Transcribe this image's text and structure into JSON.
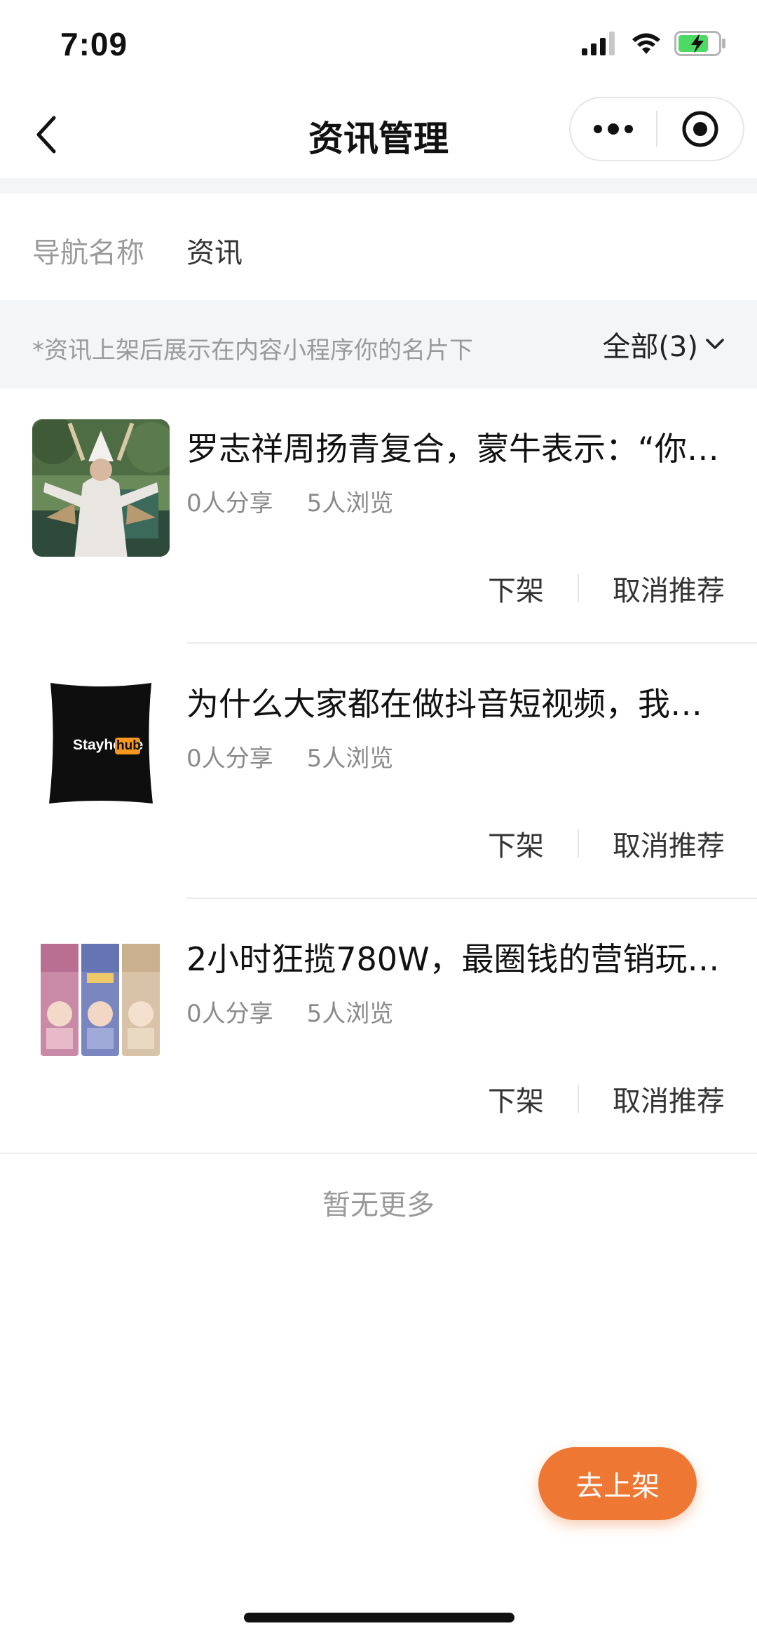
{
  "status_bar": {
    "time": "7:09"
  },
  "nav": {
    "title": "资讯管理"
  },
  "nav_name": {
    "label": "导航名称",
    "value": "资讯"
  },
  "notice": {
    "text": "*资讯上架后展示在内容小程序你的名片下",
    "filter_label": "全部(3)"
  },
  "articles": [
    {
      "title": "罗志祥周扬青复合，蒙牛表示：“你…",
      "shares": "0人分享",
      "views": "5人浏览",
      "action_unpublish": "下架",
      "action_unrecommend": "取消推荐"
    },
    {
      "title": "为什么大家都在做抖音短视频，我…",
      "shares": "0人分享",
      "views": "5人浏览",
      "action_unpublish": "下架",
      "action_unrecommend": "取消推荐",
      "thumb_text_a": "Stayhome",
      "thumb_text_b": "hub"
    },
    {
      "title": "2小时狂揽780W，最圈钱的营销玩…",
      "shares": "0人分享",
      "views": "5人浏览",
      "action_unpublish": "下架",
      "action_unrecommend": "取消推荐"
    }
  ],
  "footer": {
    "no_more": "暂无更多"
  },
  "fab": {
    "label": "去上架"
  },
  "colors": {
    "accent": "#ee7733",
    "background_gray": "#f4f5f7"
  }
}
